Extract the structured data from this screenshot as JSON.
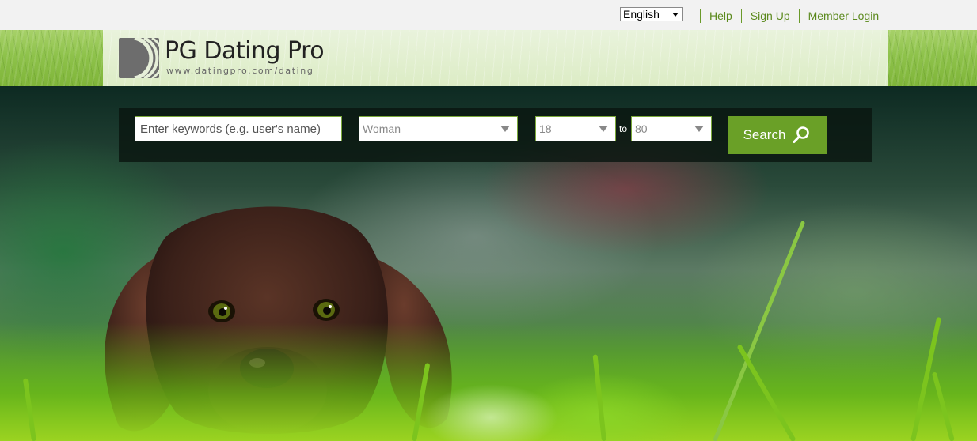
{
  "topbar": {
    "language": {
      "selected": "English"
    },
    "links": [
      "Help",
      "Sign Up",
      "Member Login"
    ]
  },
  "logo": {
    "title": "PG Dating Pro",
    "subtitle": "www.datingpro.com/dating"
  },
  "search": {
    "keywords_placeholder": "Enter keywords (e.g. user's name)",
    "gender_selected": "Woman",
    "age_from": "18",
    "age_to": "80",
    "to_label": "to",
    "button_label": "Search",
    "button_icon": "search-icon"
  },
  "colors": {
    "accent_green": "#6aa027",
    "link_green": "#5c8a1e",
    "searchbar_bg": "#0a1610"
  }
}
